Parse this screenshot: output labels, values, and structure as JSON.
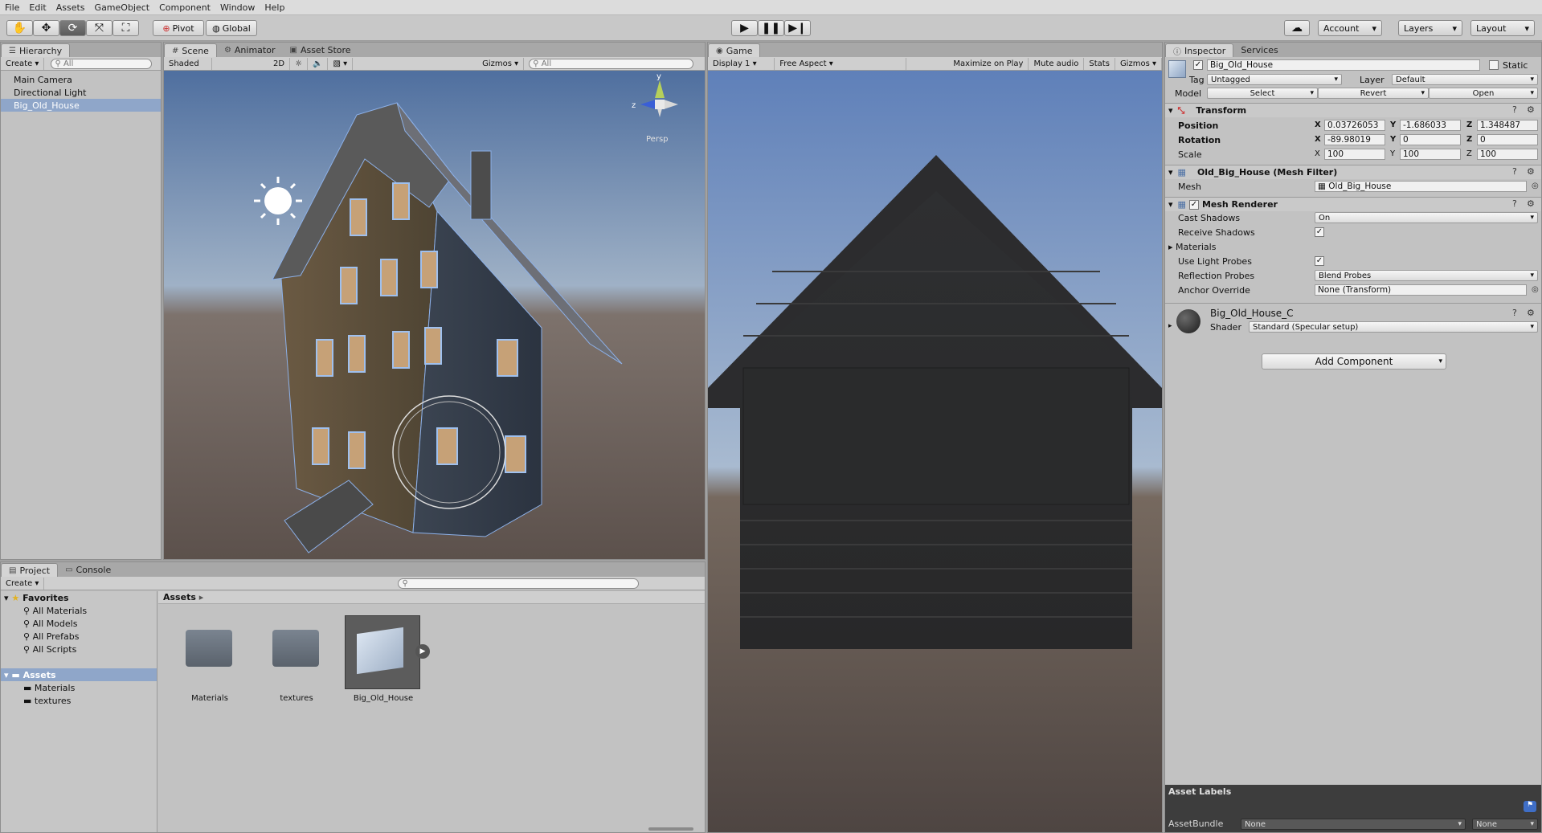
{
  "menu": [
    "File",
    "Edit",
    "Assets",
    "GameObject",
    "Component",
    "Window",
    "Help"
  ],
  "toolbar": {
    "pivot": "Pivot",
    "global": "Global",
    "account": "Account",
    "layers": "Layers",
    "layout": "Layout"
  },
  "hierarchy": {
    "tab": "Hierarchy",
    "create": "Create",
    "search_placeholder": "All",
    "items": [
      "Main Camera",
      "Directional Light",
      "Big_Old_House"
    ]
  },
  "scene": {
    "tabs": [
      "Scene",
      "Animator",
      "Asset Store"
    ],
    "shading": "Shaded",
    "toggle_2d": "2D",
    "gizmos": "Gizmos",
    "search_placeholder": "All",
    "persp": "Persp",
    "axis_y": "y",
    "axis_z": "z"
  },
  "game": {
    "tab": "Game",
    "display": "Display 1",
    "aspect": "Free Aspect",
    "buttons": [
      "Maximize on Play",
      "Mute audio",
      "Stats",
      "Gizmos"
    ]
  },
  "project": {
    "tabs": [
      "Project",
      "Console"
    ],
    "create": "Create",
    "favorites_label": "Favorites",
    "favorites": [
      "All Materials",
      "All Models",
      "All Prefabs",
      "All Scripts"
    ],
    "assets_label": "Assets",
    "asset_folders": [
      "Materials",
      "textures"
    ],
    "breadcrumb": "Assets",
    "grid_items": [
      "Materials",
      "textures",
      "Big_Old_House"
    ]
  },
  "inspector": {
    "tabs": [
      "Inspector",
      "Services"
    ],
    "object_name": "Big_Old_House",
    "static_label": "Static",
    "tag_label": "Tag",
    "tag_value": "Untagged",
    "layer_label": "Layer",
    "layer_value": "Default",
    "model_label": "Model",
    "model_buttons": [
      "Select",
      "Revert",
      "Open"
    ],
    "transform": {
      "title": "Transform",
      "position_label": "Position",
      "rotation_label": "Rotation",
      "scale_label": "Scale",
      "position": {
        "x": "0.03726053",
        "y": "-1.686033",
        "z": "1.348487"
      },
      "rotation": {
        "x": "-89.98019",
        "y": "0",
        "z": "0"
      },
      "scale": {
        "x": "100",
        "y": "100",
        "z": "100"
      }
    },
    "mesh_filter": {
      "title": "Old_Big_House (Mesh Filter)",
      "mesh_label": "Mesh",
      "mesh_value": "Old_Big_House"
    },
    "mesh_renderer": {
      "title": "Mesh Renderer",
      "cast_shadows_label": "Cast Shadows",
      "cast_shadows_value": "On",
      "receive_shadows_label": "Receive Shadows",
      "materials_label": "Materials",
      "light_probes_label": "Use Light Probes",
      "reflection_probes_label": "Reflection Probes",
      "reflection_probes_value": "Blend Probes",
      "anchor_override_label": "Anchor Override",
      "anchor_override_value": "None (Transform)"
    },
    "material": {
      "name": "Big_Old_House_C",
      "shader_label": "Shader",
      "shader_value": "Standard (Specular setup)"
    },
    "add_component": "Add Component",
    "asset_labels": "Asset Labels",
    "asset_bundle_label": "AssetBundle",
    "asset_bundle_value": "None",
    "asset_bundle_variant": "None"
  },
  "colors": {
    "selection": "#8fa6c9",
    "sky_top": "#5f7fb7",
    "sky_horizon": "#a9bcd1",
    "ground": "#5a514d"
  }
}
